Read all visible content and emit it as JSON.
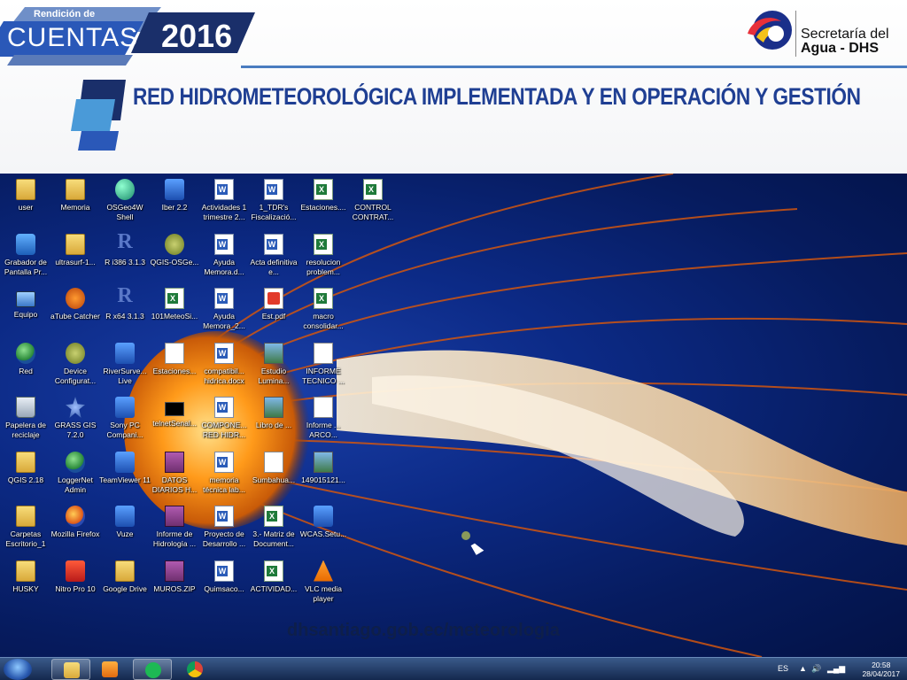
{
  "header": {
    "badge_small": "Rendición de",
    "badge_main": "CUENTAS",
    "badge_year": "2016",
    "logo_line1": "Secretaría del",
    "logo_line2": "Agua - DHS",
    "title": "RED HIDROMETEOROLÓGICA IMPLEMENTADA Y EN OPERACIÓN Y GESTIÓN"
  },
  "desktop": {
    "columns": [
      {
        "icons": [
          {
            "label": "user",
            "icon": "folder-icon",
            "style": "g-folder"
          },
          {
            "label": "Grabador de Pantalla Pr...",
            "icon": "camera-icon",
            "style": "g-camera"
          },
          {
            "label": "Equipo",
            "icon": "computer-icon",
            "style": "g-computer"
          },
          {
            "label": "Red",
            "icon": "network-icon",
            "style": "g-globe"
          },
          {
            "label": "Papelera de reciclaje",
            "icon": "recycle-bin-icon",
            "style": "g-trash"
          },
          {
            "label": "QGIS 2.18",
            "icon": "folder-icon",
            "style": "g-folder"
          },
          {
            "label": "Carpetas Escritorio_1",
            "icon": "folder-icon",
            "style": "g-folder"
          },
          {
            "label": "HUSKY",
            "icon": "folder-icon",
            "style": "g-folder"
          }
        ]
      },
      {
        "icons": [
          {
            "label": "Memoria",
            "icon": "folder-icon",
            "style": "g-folder"
          },
          {
            "label": "ultrasurf-1...",
            "icon": "folder-icon",
            "style": "g-folder"
          },
          {
            "label": "aTube Catcher",
            "icon": "atube-icon",
            "style": "g-tube"
          },
          {
            "label": "Device Configurat...",
            "icon": "device-config-icon",
            "style": "g-gear"
          },
          {
            "label": "GRASS GIS 7.2.0",
            "icon": "grass-gis-icon",
            "style": "g-star"
          },
          {
            "label": "LoggerNet Admin",
            "icon": "loggernet-icon",
            "style": "g-globe"
          },
          {
            "label": "Mozilla Firefox",
            "icon": "firefox-icon",
            "style": "g-firefox"
          },
          {
            "label": "Nitro Pro 10",
            "icon": "nitro-icon",
            "style": "g-nitro"
          }
        ]
      },
      {
        "icons": [
          {
            "label": "OSGeo4W Shell",
            "icon": "osgeo-icon",
            "style": "g-sphere"
          },
          {
            "label": "R i386 3.1.3",
            "icon": "r-icon",
            "style": "g-r"
          },
          {
            "label": "R x64 3.1.3",
            "icon": "r-icon",
            "style": "g-r"
          },
          {
            "label": "RiverSurve... Live",
            "icon": "riversurveyor-icon",
            "style": "g-box"
          },
          {
            "label": "Sony PC Compani...",
            "icon": "sony-icon",
            "style": "g-box"
          },
          {
            "label": "TeamViewer 11",
            "icon": "teamviewer-icon",
            "style": "g-box"
          },
          {
            "label": "Vuze",
            "icon": "vuze-icon",
            "style": "g-box"
          },
          {
            "label": "Google Drive",
            "icon": "google-drive-icon",
            "style": "g-folder"
          }
        ]
      },
      {
        "icons": [
          {
            "label": "Iber 2.2",
            "icon": "iber-icon",
            "style": "g-box"
          },
          {
            "label": "QGIS-OSGe...",
            "icon": "qgis-icon",
            "style": "g-gear"
          },
          {
            "label": "101MeteoSi...",
            "icon": "excel-icon",
            "style": "g-excel"
          },
          {
            "label": "Estaciones...",
            "icon": "document-icon",
            "style": "g-doc"
          },
          {
            "label": "telnetSenal...",
            "icon": "terminal-icon",
            "style": "g-black"
          },
          {
            "label": "DATOS DIARIOS H...",
            "icon": "winrar-icon",
            "style": "g-rar"
          },
          {
            "label": "Informe de Hidrología ...",
            "icon": "winrar-icon",
            "style": "g-rar"
          },
          {
            "label": "MUROS.ZIP",
            "icon": "winrar-icon",
            "style": "g-rar"
          }
        ]
      },
      {
        "icons": [
          {
            "label": "Actividades 1 trimestre 2...",
            "icon": "word-icon",
            "style": "g-word"
          },
          {
            "label": "Ayuda Memora.d...",
            "icon": "word-icon",
            "style": "g-word"
          },
          {
            "label": "Ayuda Memora_2...",
            "icon": "word-icon",
            "style": "g-word"
          },
          {
            "label": "compatibil... hidrica.docx",
            "icon": "word-icon",
            "style": "g-word"
          },
          {
            "label": "COMPONE... RED HIDR...",
            "icon": "word-icon",
            "style": "g-word"
          },
          {
            "label": "memoria técnica lab...",
            "icon": "word-icon",
            "style": "g-word"
          },
          {
            "label": "Proyecto de Desarrollo ...",
            "icon": "word-icon",
            "style": "g-word"
          },
          {
            "label": "Quimsaco...",
            "icon": "word-icon",
            "style": "g-word"
          }
        ]
      },
      {
        "icons": [
          {
            "label": "1_TDR's Fiscalizació...",
            "icon": "word-icon",
            "style": "g-word"
          },
          {
            "label": "Acta definitiva e...",
            "icon": "word-icon",
            "style": "g-word"
          },
          {
            "label": "Est.pdf",
            "icon": "pdf-icon",
            "style": "g-pdf"
          },
          {
            "label": "Estudio Lumina...",
            "icon": "image-icon",
            "style": "g-img"
          },
          {
            "label": "Libro de ...",
            "icon": "image-icon",
            "style": "g-img"
          },
          {
            "label": "Sumbahua...",
            "icon": "document-icon",
            "style": "g-doc"
          },
          {
            "label": "3.- Matriz de Document...",
            "icon": "excel-icon",
            "style": "g-excel"
          },
          {
            "label": "ACTIVIDAD...",
            "icon": "excel-icon",
            "style": "g-excel"
          }
        ]
      },
      {
        "icons": [
          {
            "label": "Estaciones....",
            "icon": "excel-icon",
            "style": "g-excel"
          },
          {
            "label": "resolucion problem...",
            "icon": "excel-icon",
            "style": "g-excel"
          },
          {
            "label": "macro consolidar...",
            "icon": "excel-icon",
            "style": "g-excel"
          },
          {
            "label": "INFORME TECNICO ...",
            "icon": "document-icon",
            "style": "g-doc"
          },
          {
            "label": "Informe ... ARCO...",
            "icon": "document-icon",
            "style": "g-doc"
          },
          {
            "label": "149015121...",
            "icon": "image-icon",
            "style": "g-img"
          },
          {
            "label": "WCAS.Setu...",
            "icon": "installer-icon",
            "style": "g-box"
          },
          {
            "label": "VLC media player",
            "icon": "vlc-icon",
            "style": "g-vlc"
          }
        ]
      },
      {
        "icons": [
          {
            "label": "CONTROL CONTRAT...",
            "icon": "excel-icon",
            "style": "g-excel"
          }
        ]
      }
    ],
    "url": "dhsantiago.gob.ec/meteorologia"
  },
  "taskbar": {
    "language": "ES",
    "time": "20:58",
    "date": "28/04/2017"
  },
  "colors": {
    "title": "#1f3f93",
    "header_rule": "#4a7cc0",
    "desktop_bg": "#0c2a86",
    "taskbar": "#14284e"
  }
}
